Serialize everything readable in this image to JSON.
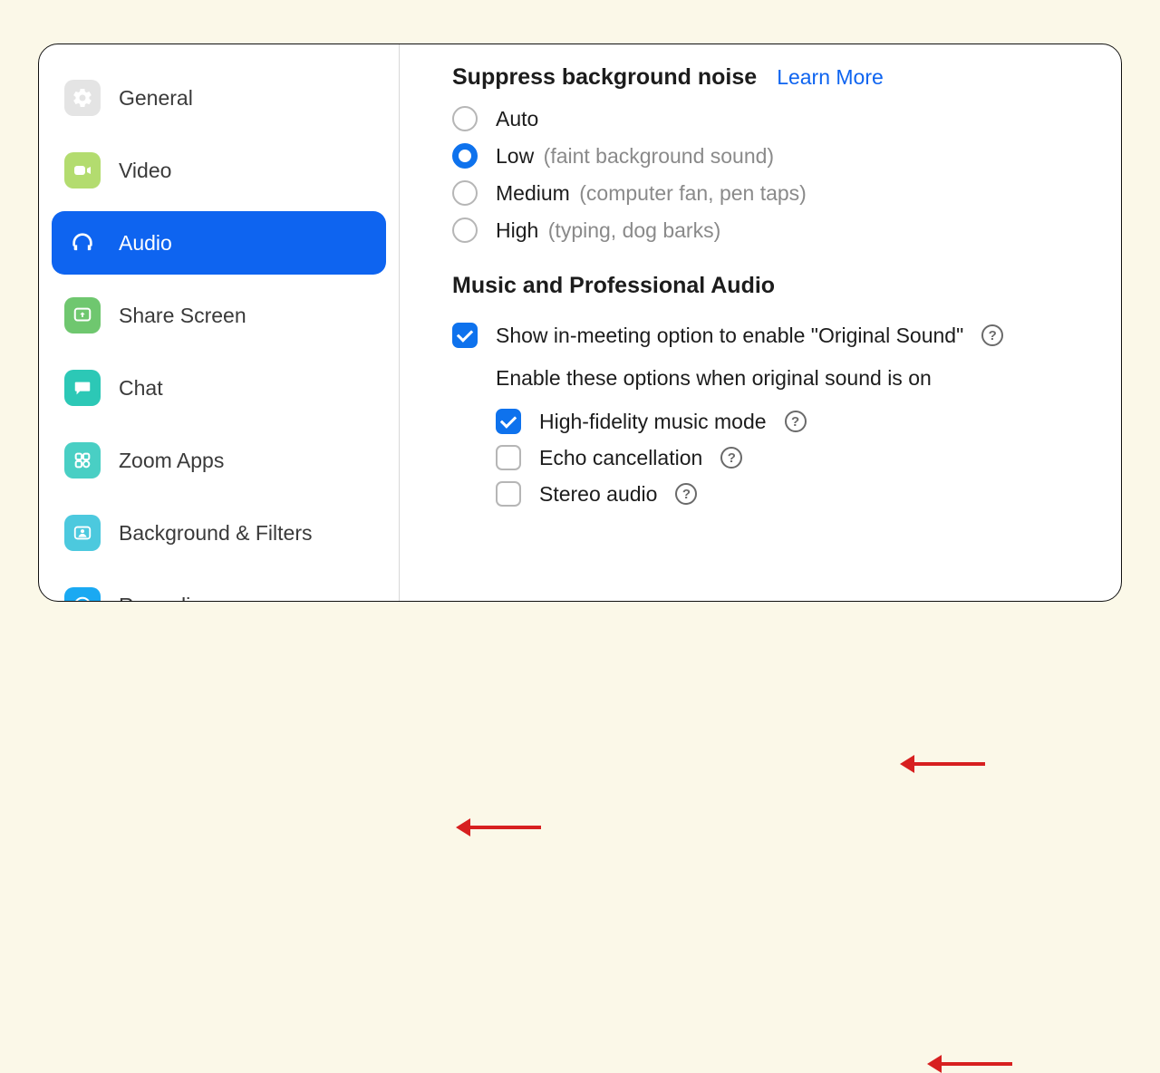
{
  "sidebar": {
    "items": [
      {
        "id": "general",
        "label": "General"
      },
      {
        "id": "video",
        "label": "Video"
      },
      {
        "id": "audio",
        "label": "Audio"
      },
      {
        "id": "share",
        "label": "Share Screen"
      },
      {
        "id": "chat",
        "label": "Chat"
      },
      {
        "id": "apps",
        "label": "Zoom Apps"
      },
      {
        "id": "bgfilters",
        "label": "Background & Filters"
      },
      {
        "id": "recording",
        "label": "Recording"
      }
    ],
    "active": "audio"
  },
  "suppress": {
    "title": "Suppress background noise",
    "learn_more": "Learn More",
    "options": [
      {
        "value": "auto",
        "label": "Auto",
        "desc": ""
      },
      {
        "value": "low",
        "label": "Low",
        "desc": "(faint background sound)"
      },
      {
        "value": "medium",
        "label": "Medium",
        "desc": "(computer fan, pen taps)"
      },
      {
        "value": "high",
        "label": "High",
        "desc": "(typing, dog barks)"
      }
    ],
    "selected": "low"
  },
  "music": {
    "title": "Music and Professional Audio",
    "show_original_label": "Show in-meeting option to enable \"Original Sound\"",
    "show_original_checked": true,
    "enable_hint": "Enable these options when original sound is on",
    "options": [
      {
        "id": "hifi",
        "label": "High-fidelity music mode",
        "checked": true,
        "help": true
      },
      {
        "id": "echo",
        "label": "Echo cancellation",
        "checked": false,
        "help": true
      },
      {
        "id": "stereo",
        "label": "Stereo audio",
        "checked": false,
        "help": true
      }
    ]
  },
  "help_glyph": "?",
  "annotations": {
    "arrow_to_audio_tab": true,
    "arrow_to_low_option": true,
    "arrow_to_hifi_option": true
  }
}
